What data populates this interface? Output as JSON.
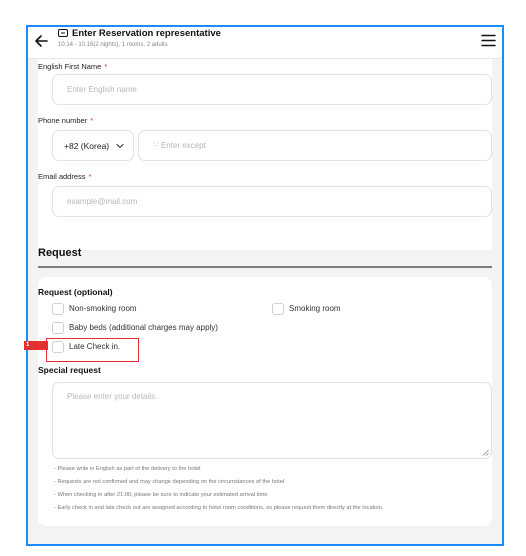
{
  "header": {
    "title": "Enter Reservation representative",
    "subtitle": "10.14 - 10.16(2 nights), 1 rooms, 2 adults"
  },
  "guest_form": {
    "first_name_label": "English First Name",
    "first_name_placeholder": "Enter English name",
    "phone_label": "Phone number",
    "country_code": "+82 (Korea)",
    "phone_placeholder": "'-' Enter except",
    "email_label": "Email address",
    "email_placeholder": "example@mail.com",
    "required_mark": "*"
  },
  "request": {
    "section_title": "Request",
    "optional_title": "Request (optional)",
    "options": [
      "Non-smoking room",
      "Smoking room",
      "Baby beds (additional charges may apply)",
      "Late Check in."
    ],
    "special_title": "Special request",
    "special_placeholder": "Please enter your details.",
    "notes": [
      "- Please write in English as part of the delivery to the hotel.",
      "- Requests are not confirmed and may change depending on the circumstances of the hotel.",
      "- When checking in after 21:00, please be sure to indicate your estimated arrival time.",
      "- Early check in and late check out are assigned according to hotel room conditions, so please request them directly at the location."
    ]
  },
  "annotation": {
    "badge": "1"
  },
  "colors": {
    "accent_border": "#1a8cff",
    "required": "#e0312d",
    "highlight": "#e0312d"
  }
}
